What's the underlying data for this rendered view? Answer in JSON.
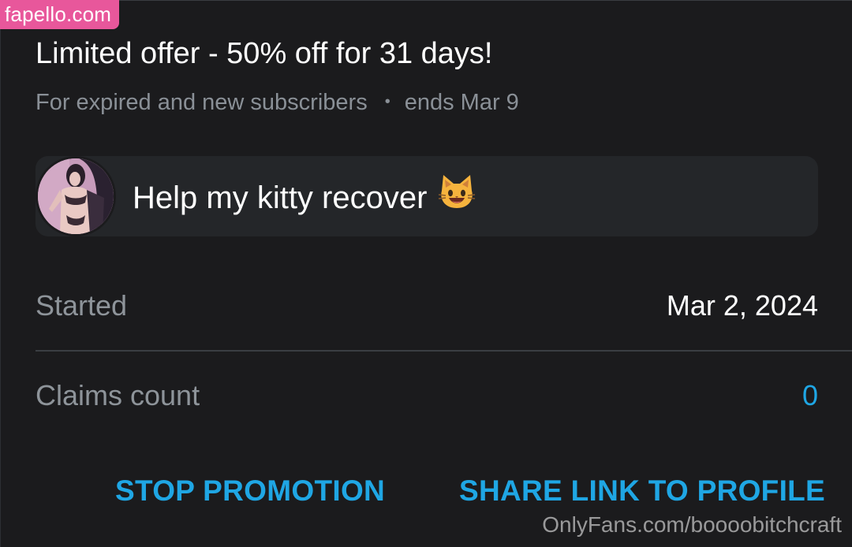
{
  "watermarks": {
    "top": "fapello.com",
    "bottom": "OnlyFans.com/boooobitchcraft"
  },
  "offer": {
    "title": "Limited offer - 50% off for 31 days!",
    "audience": "For expired and new subscribers",
    "separator": "•",
    "ends": "ends Mar 9"
  },
  "promo": {
    "message": "Help my kitty recover",
    "emoji_icon": "smiling-cat-icon"
  },
  "details": {
    "started_label": "Started",
    "started_value": "Mar 2, 2024",
    "claims_label": "Claims count",
    "claims_value": "0"
  },
  "actions": {
    "stop_label": "STOP PROMOTION",
    "share_label": "SHARE LINK TO PROFILE"
  },
  "colors": {
    "background": "#1b1b1d",
    "card": "#242629",
    "accent": "#1fa6e4",
    "muted_text": "#8e949a",
    "watermark_pink": "#e8579b"
  }
}
